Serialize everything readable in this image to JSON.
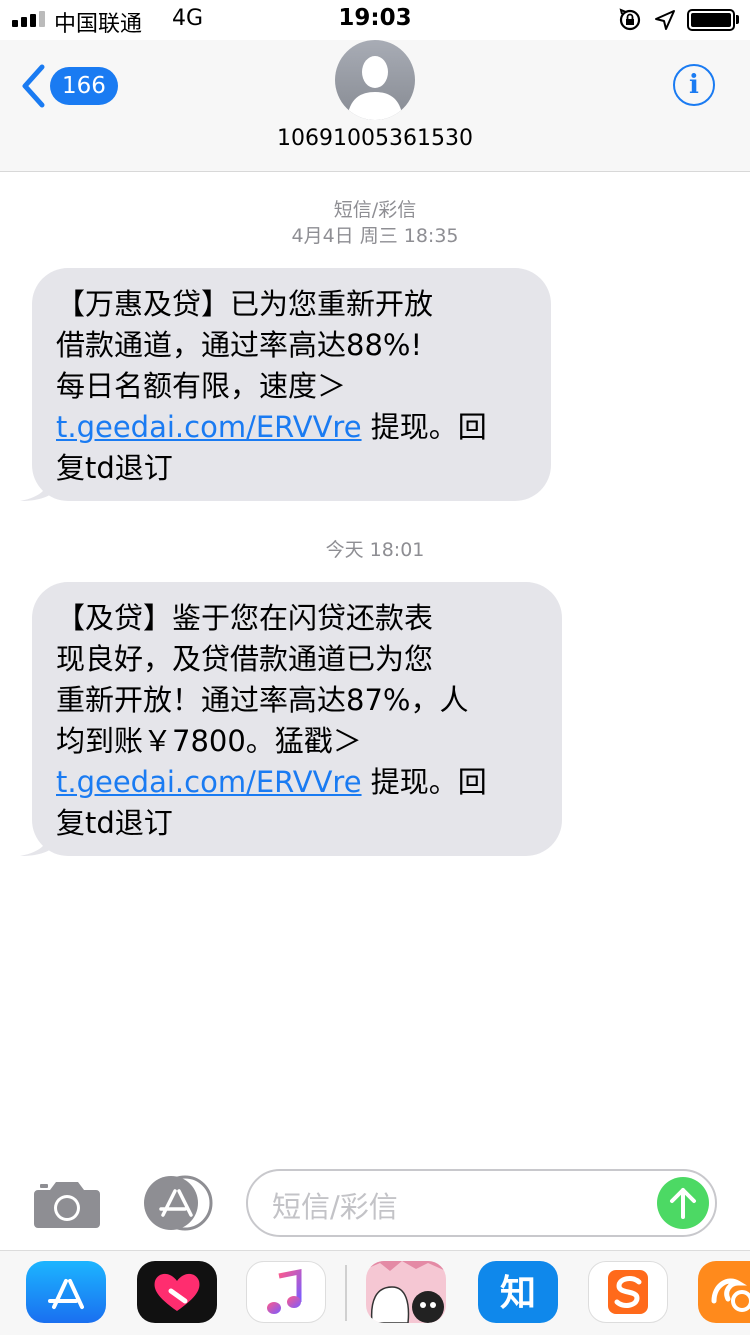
{
  "status_bar": {
    "carrier": "中国联通",
    "network": "4G",
    "time": "19:03"
  },
  "nav": {
    "back_count": "166",
    "contact": "10691005361530",
    "info_label": "i"
  },
  "messages": [
    {
      "type_label": "短信/彩信",
      "timestamp": "4月4日 周三 18:35",
      "lines": [
        "【万惠及贷】已为您重新开放",
        "借款通道，通过率高达88%!",
        "每日名额有限，速度＞"
      ],
      "link": "t.geedai.com/ERVVre",
      "after_link": " 提现。回",
      "last_line": "复td退订"
    },
    {
      "timestamp": "今天 18:01",
      "lines": [
        "【及贷】鉴于您在闪贷还款表",
        "现良好，及贷借款通道已为您",
        "重新开放！通过率高达87%，人",
        "均到账￥7800。猛戳＞"
      ],
      "link": "t.geedai.com/ERVVre",
      "after_link": " 提现。回",
      "last_line": "复td退订"
    }
  ],
  "input": {
    "placeholder": "短信/彩信"
  },
  "app_drawer": {
    "apps": [
      "app-store-icon",
      "digital-touch-icon",
      "music-icon",
      "animoji-sticker-icon",
      "zhihu-icon",
      "sogou-icon",
      "uc-browser-icon"
    ],
    "zhihu_glyph": "知",
    "colors": {
      "app_store": "#1a8cff",
      "zhihu": "#0f88eb",
      "sogou": "#ff6a1b",
      "uc": "#ff8a1c",
      "send": "#4cd964",
      "link": "#1a7bf2"
    }
  }
}
